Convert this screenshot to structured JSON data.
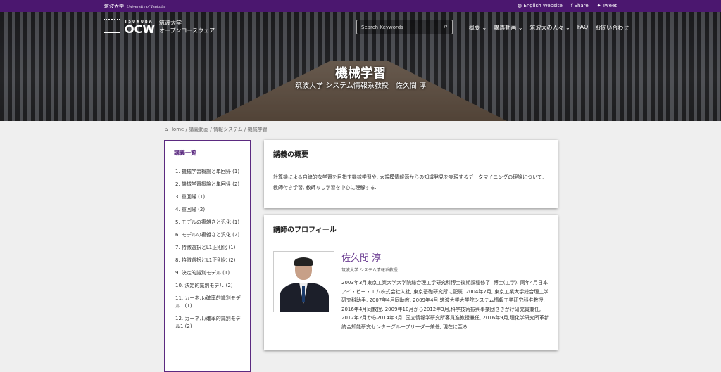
{
  "topbar": {
    "university": "筑波大学",
    "university_en": "University of Tsukuba",
    "english": "English Website",
    "share": "Share",
    "tweet": "Tweet"
  },
  "logo": {
    "small": "TSUKUBA",
    "big": "OCW",
    "jp1": "筑波大学",
    "jp2": "オープンコースウェア"
  },
  "search": {
    "placeholder": "Search Keywords"
  },
  "nav": [
    "概要 ⌄",
    "講義動画 ⌄",
    "筑波大の人々 ⌄",
    "FAQ",
    "お問い合わせ"
  ],
  "hero": {
    "title": "機械学習",
    "subtitle": "筑波大学 システム情報系教授　佐久間 淳"
  },
  "breadcrumb": {
    "home": "Home",
    "b1": "講義動画",
    "b2": "情報システム",
    "current": "機械学習"
  },
  "sidebar": {
    "title": "講義一覧",
    "items": [
      "1. 機械学習概論と単回帰 (1)",
      "2. 機械学習概論と単回帰 (2)",
      "3. 重回帰 (1)",
      "4. 重回帰 (2)",
      "5. モデルの複雑さと汎化 (1)",
      "6. モデルの複雑さと汎化 (2)",
      "7. 特徴選択とL1正則化 (1)",
      "8. 特徴選択とL1正則化 (2)",
      "9. 決定的識別モデル (1)",
      "10. 決定的識別モデル (2)",
      "11. カーネル/確率的識別モデル1 (1)",
      "12. カーネル/確率的識別モデル1 (2)"
    ]
  },
  "overview": {
    "title": "講義の概要",
    "text": "計算機による自律的な学習を目指す機械学習や, 大規模情報源からの知識発見を実現するデータマイニングの理論について, 教師付き学習, 教師なし学習を中心に理解する."
  },
  "profile": {
    "title": "講師のプロフィール",
    "name": "佐久間 淳",
    "affiliation": "筑波大学 システム情報系教授",
    "bio": "2003年3月東京工業大学大学院総合理工学研究科博士後期課程修了. 博士(工学). 同年4月日本アイ・ビー・エム株式会社入社, 東京基礎研究所に配属. 2004年7月, 東京工業大学総合理工学研究科助手, 2007年4月同助教, 2009年4月,筑波大学大学院システム情報工学研究科准教授, 2016年4月同教授. 2009年10月から2012年3月,科学技術振興事業団さきがけ研究員兼任, 2012年2月から2014年3月, 国立情報学研究所客員准教授兼任, 2016年9月,理化学研究所革新統合知能研究センターグループリーダー兼任, 現在に至る."
  }
}
